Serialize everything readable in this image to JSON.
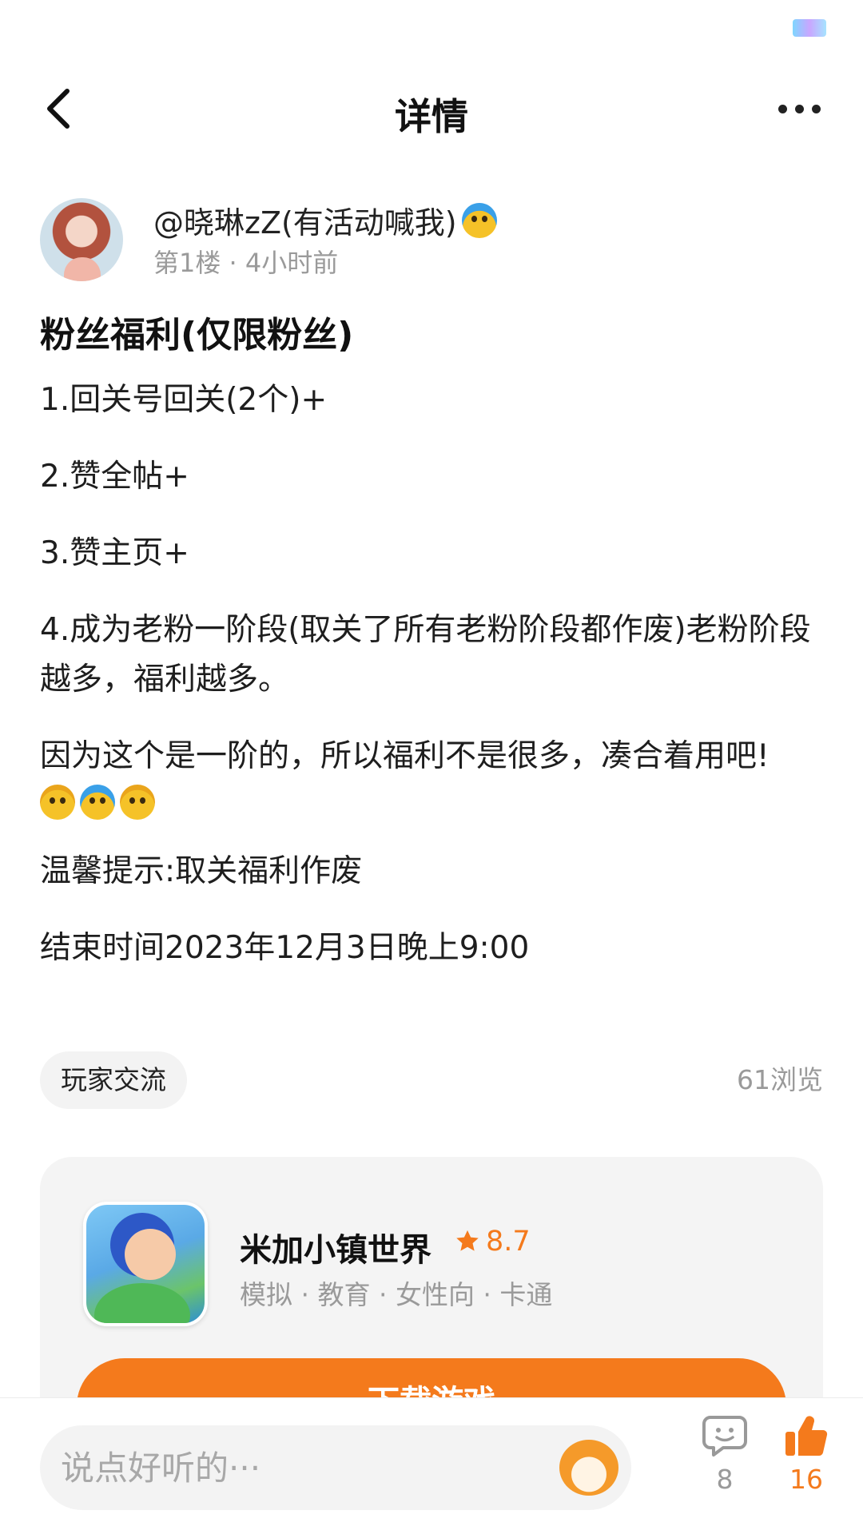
{
  "header": {
    "title": "详情"
  },
  "author": {
    "name": "@晓琳zZ(有活动喊我)",
    "meta": "第1楼 · 4小时前"
  },
  "post": {
    "title": "粉丝福利(仅限粉丝)",
    "paragraphs": [
      "1.回关号回关(2个)+",
      "2.赞全帖+",
      "3.赞主页+",
      "4.成为老粉一阶段(取关了所有老粉阶段都作废)老粉阶段越多，福利越多。",
      "因为这个是一阶的，所以福利不是很多，凑合着用吧!",
      "温馨提示:取关福利作废",
      "结束时间2023年12月3日晚上9:00"
    ]
  },
  "tag": {
    "label": "玩家交流"
  },
  "views": "61浏览",
  "game": {
    "name": "米加小镇世界",
    "rating": "8.7",
    "tags": "模拟 · 教育 · 女性向 · 卡通",
    "button_label": "下载游戏"
  },
  "bottom": {
    "placeholder": "说点好听的···",
    "comment_count": "8",
    "like_count": "16"
  },
  "colors": {
    "accent": "#f47a1c",
    "muted_text": "#9a9a9a"
  }
}
